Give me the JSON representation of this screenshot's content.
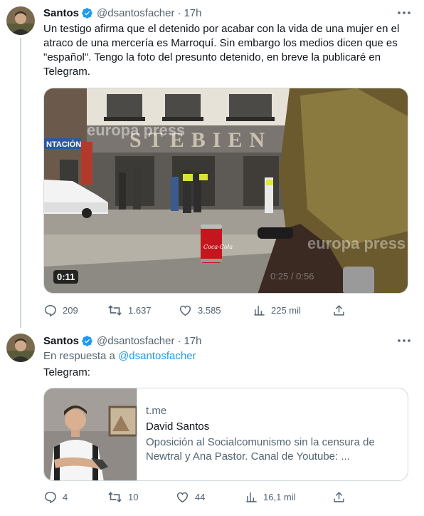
{
  "tweets": [
    {
      "author": {
        "name": "Santos",
        "handle": "@dsantosfacher"
      },
      "separator": "·",
      "time": "17h",
      "text": "Un testigo afirma que el detenido por acabar con la vida de una mujer en el atraco de una mercería es Marroquí. Sin embargo los medios dicen que es \"español\". Tengo la foto del presunto detenido, en breve la publicaré en Telegram.",
      "video": {
        "duration": "0:11",
        "watermark": "europa press",
        "storefront_sign": "STEBIEN",
        "side_sign": "NTACIÓN",
        "can_label": "Coca-Cola",
        "overlay_time": "0:25 / 0:56"
      },
      "stats": {
        "replies": "209",
        "retweets": "1.637",
        "likes": "3.585",
        "views": "225 mil"
      }
    },
    {
      "author": {
        "name": "Santos",
        "handle": "@dsantosfacher"
      },
      "separator": "·",
      "time": "17h",
      "reply_prefix": "En respuesta a",
      "reply_to": "@dsantosfacher",
      "text": "Telegram:",
      "card": {
        "domain": "t.me",
        "title": "David Santos",
        "description": "Oposición al Socialcomunismo sin la censura de Newtral y Ana Pastor. Canal de Youtube: ..."
      },
      "stats": {
        "replies": "4",
        "retweets": "10",
        "likes": "44",
        "views": "16,1 mil"
      }
    }
  ],
  "colors": {
    "text": "#0f1419",
    "secondary": "#536471",
    "link": "#1d9bf0",
    "verified": "#1d9bf0",
    "border": "#cfd9de"
  }
}
